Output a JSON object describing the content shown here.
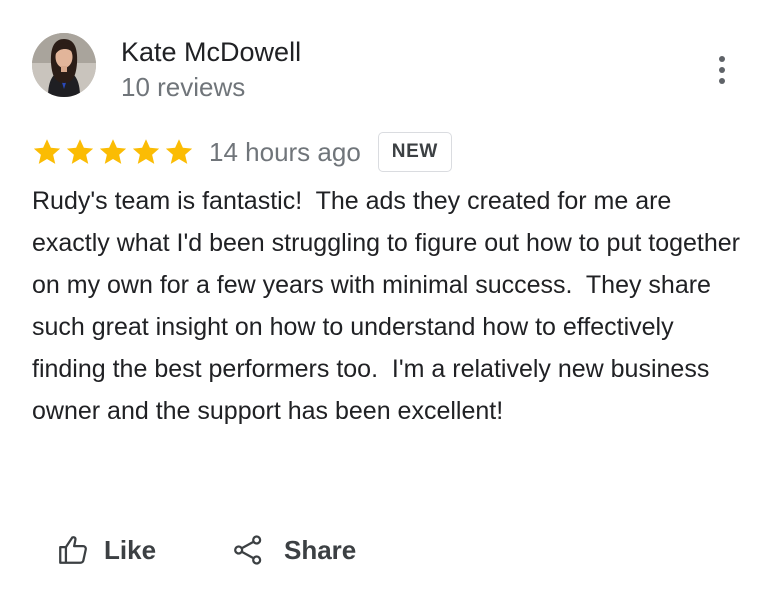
{
  "reviewer": {
    "name": "Kate McDowell",
    "meta": "10 reviews",
    "avatar_icon": "person-photo-avatar"
  },
  "menu": {
    "icon": "more-vert-icon"
  },
  "rating": {
    "stars": 5,
    "max_stars": 5,
    "star_color": "#fbbc04",
    "time": "14 hours ago",
    "badge": "NEW"
  },
  "review": {
    "text": "Rudy's team is fantastic!  The ads they created for me are exactly what I'd been struggling to figure out how to put together on my own for a few years with minimal success.  They share such great insight on how to understand how to effectively finding the best performers too.  I'm a relatively new business owner and the support has been excellent!"
  },
  "actions": {
    "like_label": "Like",
    "like_icon": "thumb-up-icon",
    "share_label": "Share",
    "share_icon": "share-icon"
  }
}
